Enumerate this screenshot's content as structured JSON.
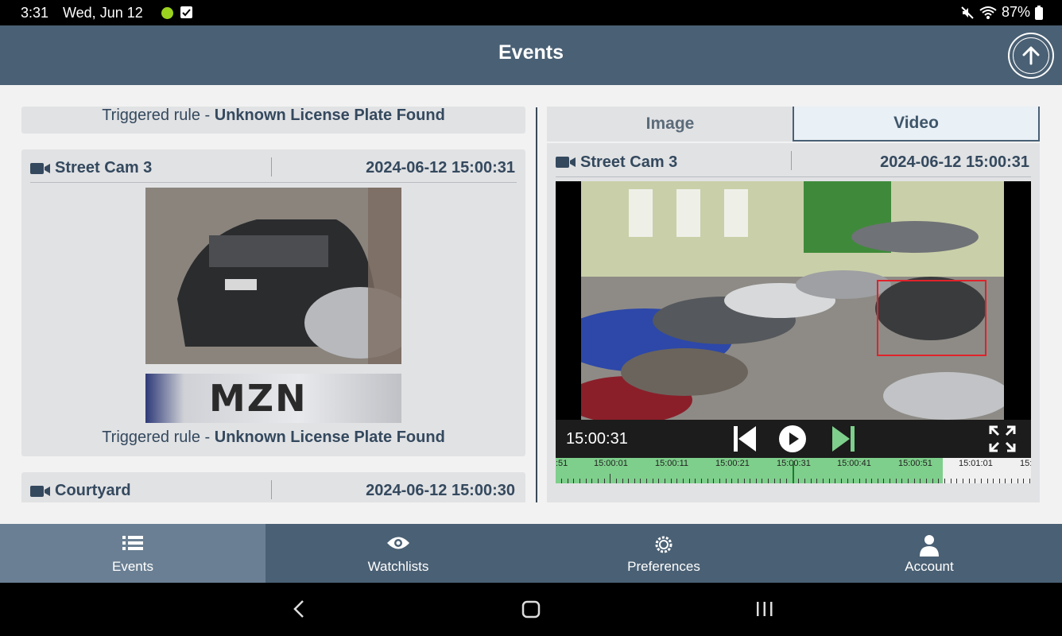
{
  "status_bar": {
    "time": "3:31",
    "date": "Wed, Jun 12",
    "battery": "87%"
  },
  "header": {
    "title": "Events"
  },
  "events": [
    {
      "rule_prefix": "Triggered rule - ",
      "rule_name": "Unknown License Plate Found"
    },
    {
      "camera": "Street Cam 3",
      "timestamp": "2024-06-12 15:00:31",
      "plate_text": "MZN",
      "rule_prefix": "Triggered rule - ",
      "rule_name": "Unknown License Plate Found"
    },
    {
      "camera": "Courtyard",
      "timestamp": "2024-06-12 15:00:30"
    }
  ],
  "detail": {
    "tabs": [
      "Image",
      "Video"
    ],
    "active_tab": "Video",
    "camera": "Street Cam 3",
    "timestamp": "2024-06-12 15:00:31",
    "player_time": "15:00:31",
    "timeline_labels": [
      ":51",
      "15:00:01",
      "15:00:11",
      "15:00:21",
      "15:00:31",
      "15:00:41",
      "15:00:51",
      "15:01:01",
      "15:"
    ]
  },
  "bottom_nav": [
    {
      "label": "Events",
      "icon": "list-icon",
      "active": true
    },
    {
      "label": "Watchlists",
      "icon": "eye-icon",
      "active": false
    },
    {
      "label": "Preferences",
      "icon": "gear-icon",
      "active": false
    },
    {
      "label": "Account",
      "icon": "person-icon",
      "active": false
    }
  ],
  "colors": {
    "primary": "#4a6074",
    "active_nav": "#6a7f93",
    "card_bg": "#e1e2e4",
    "text_dark": "#34495e",
    "timeline_green": "#7ecf8b",
    "bbox_red": "#e0222a",
    "status_dot": "#9bd21f"
  }
}
